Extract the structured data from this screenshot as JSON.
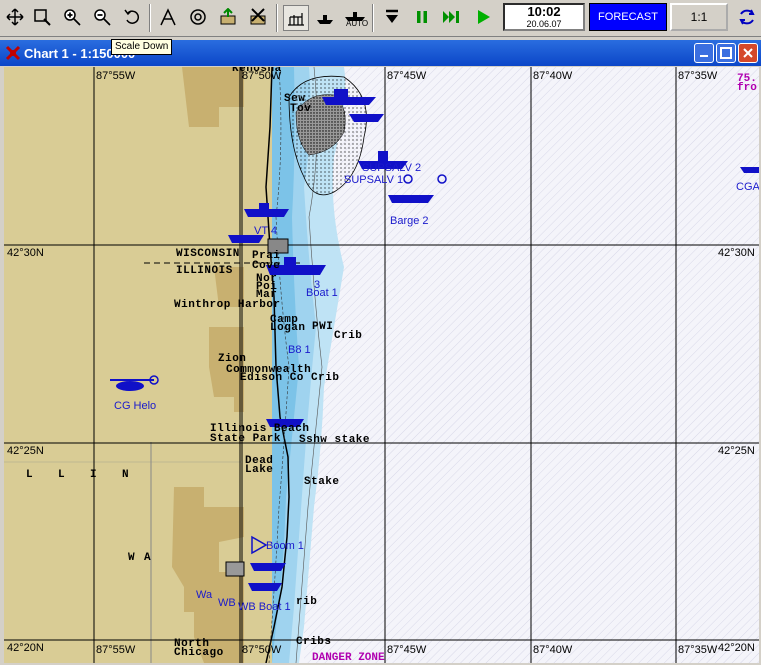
{
  "toolbar": {
    "auto_label": "AUTO",
    "clock_time": "10:02",
    "clock_date": "20.06.07",
    "forecast_label": "FORECAST",
    "scale_ratio": "1:1"
  },
  "tooltip": "Scale Down",
  "window": {
    "title": "Chart 1 - 1:150000"
  },
  "chart": {
    "lon_labels": [
      "87°55W",
      "87°50W",
      "87°45W",
      "87°40W",
      "87°35W"
    ],
    "lat_labels": [
      "42°30N",
      "42°25N",
      "42°20N"
    ],
    "places": {
      "wisconsin": "WISCONSIN",
      "illinois": "ILLINOIS",
      "winthrop": "Winthrop Harbor",
      "camp": "Camp",
      "logan": "Logan",
      "pwi": "PWI",
      "crib1": "Crib",
      "zion": "Zion",
      "commonwealth": "Commonwealth",
      "edison": "Edison Co Crib",
      "illbeach": "Illinois Beach",
      "statepark": "State Park",
      "stake1": "Sshw stake",
      "dead": "Dead",
      "lake": "Lake",
      "stake2": "Stake",
      "north": "North",
      "chicago": "Chicago",
      "cribs": "Cribs",
      "crib2": "rib",
      "prai": "Prai",
      "cove": "Cove",
      "nor": "Nor",
      "poi": "Poi",
      "mar": "Mar",
      "sew": "Sew",
      "tov": "Tov",
      "kenosha": "Kenosha",
      "ill_l": "L",
      "ill_l2": "L",
      "ill_i": "I",
      "ill_n": "N",
      "wa_w": "W",
      "wa_a": "A"
    },
    "units": {
      "supsalv2": "SUPSALV 2",
      "supsalv1": "SUPSALV 1",
      "barge2": "Barge 2",
      "vt4": "VT 4",
      "boat1": "Boat 1",
      "b3": "3",
      "cghelo": "CG Helo",
      "b81": "B8 1",
      "boom1": "Boom 1",
      "wb": "WB",
      "wbboat": "WB Boat 1",
      "wa": "Wa",
      "cga": "CGA"
    },
    "magenta": {
      "danger": "DANGER ZONE",
      "n75": "75.",
      "fro": "fro"
    }
  }
}
